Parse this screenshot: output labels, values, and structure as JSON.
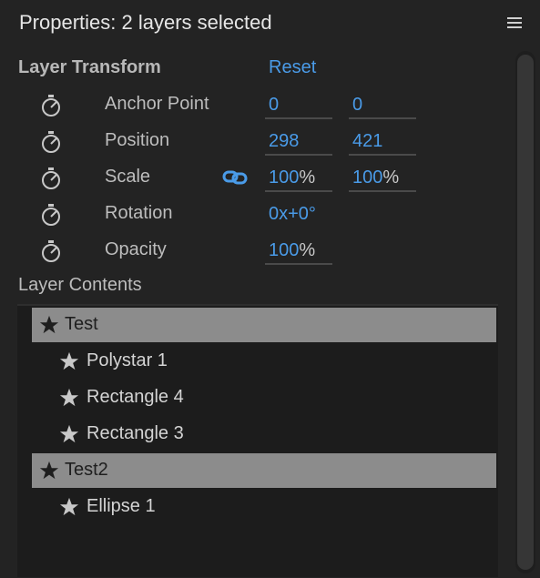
{
  "panel": {
    "title": "Properties: 2 layers selected",
    "menu_icon": "hamburger-icon"
  },
  "layer_transform": {
    "heading": "Layer Transform",
    "reset_label": "Reset",
    "properties": [
      {
        "label": "Anchor Point",
        "value1": "0",
        "value2": "0",
        "unit": ""
      },
      {
        "label": "Position",
        "value1": "298",
        "value2": "421",
        "unit": ""
      },
      {
        "label": "Scale",
        "value1": "100",
        "value2": "100",
        "unit": "%",
        "linked": true
      },
      {
        "label": "Rotation",
        "value1": "0x+0°",
        "unit": ""
      },
      {
        "label": "Opacity",
        "value1": "100",
        "unit": "%"
      }
    ]
  },
  "layer_contents": {
    "heading": "Layer Contents",
    "items": [
      {
        "label": "Test",
        "level": 0,
        "selected": true,
        "icon": "star-icon"
      },
      {
        "label": "Polystar 1",
        "level": 1,
        "selected": false,
        "icon": "star-icon"
      },
      {
        "label": "Rectangle 4",
        "level": 1,
        "selected": false,
        "icon": "star-icon"
      },
      {
        "label": "Rectangle 3",
        "level": 1,
        "selected": false,
        "icon": "star-icon"
      },
      {
        "label": "Test2",
        "level": 0,
        "selected": true,
        "icon": "star-icon"
      },
      {
        "label": "Ellipse 1",
        "level": 1,
        "selected": false,
        "icon": "star-icon"
      }
    ]
  },
  "colors": {
    "background": "#232323",
    "accent": "#4a9be8",
    "selected_row": "#8c8c8c"
  }
}
